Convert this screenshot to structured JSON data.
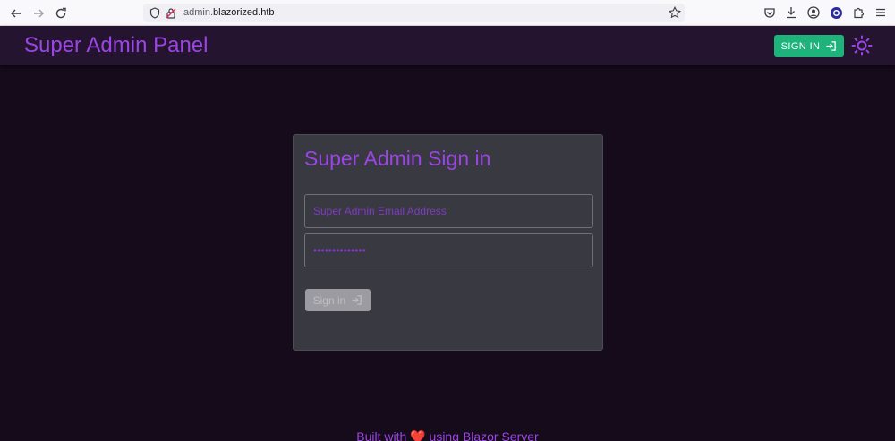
{
  "browser": {
    "url_prefix": "admin.",
    "url_domain": "blazorized.htb",
    "icons": [
      "back-icon",
      "forward-icon",
      "reload-icon",
      "shield-icon",
      "insecure-lock-icon",
      "star-icon",
      "pocket-icon",
      "download-icon",
      "account-icon",
      "extension-badge-icon",
      "extensions-icon",
      "menu-icon"
    ]
  },
  "appbar": {
    "title": "Super Admin Panel",
    "signin_label": "SIGN IN",
    "theme_icon": "sun-icon"
  },
  "card": {
    "title": "Super Admin Sign in",
    "email_placeholder": "Super Admin Email Address",
    "password_value": "••••••••••••••",
    "signin_label": "Sign in",
    "signin_icon": "login-icon"
  },
  "footer": {
    "prefix": "Built with",
    "heart": "❤️",
    "suffix": "using Blazor Server"
  },
  "colors": {
    "background": "#150b1a",
    "appbar": "#24142f",
    "accent": "#9b45e4",
    "success": "#1fb37c",
    "card": "#393941"
  }
}
